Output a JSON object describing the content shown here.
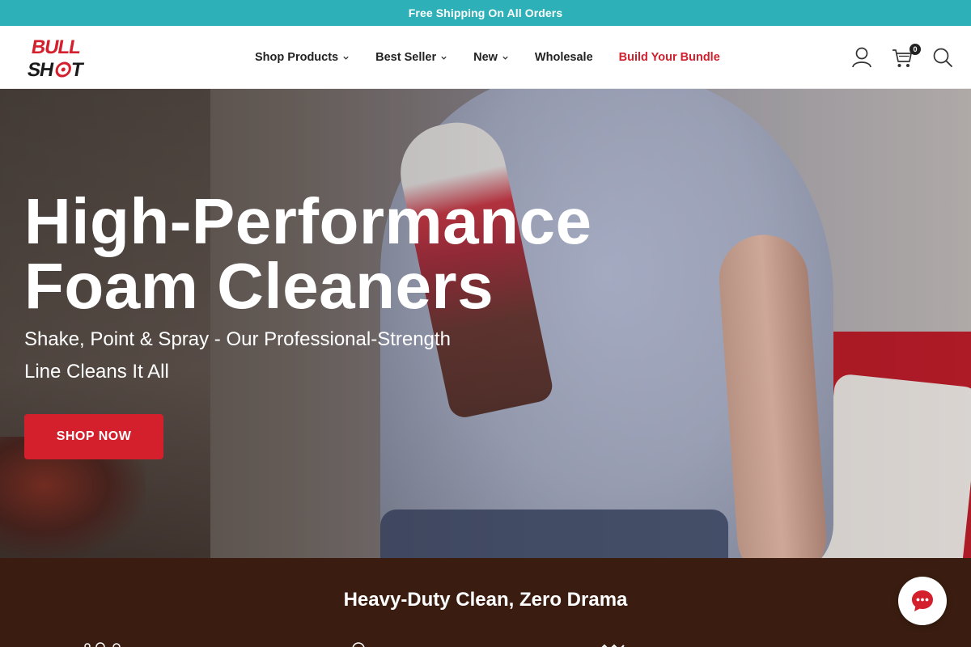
{
  "announcement": {
    "text": "Free Shipping On All Orders"
  },
  "brand": {
    "logo_line1": "BULL",
    "logo_line2": "SHOT",
    "logo_color": "#d41f2c"
  },
  "nav": {
    "items": [
      {
        "label": "Shop Products",
        "has_dropdown": true
      },
      {
        "label": "Best Seller",
        "has_dropdown": true
      },
      {
        "label": "New",
        "has_dropdown": true
      },
      {
        "label": "Wholesale",
        "has_dropdown": false
      },
      {
        "label": "Build Your Bundle",
        "has_dropdown": false,
        "accent": true
      }
    ]
  },
  "header_icons": {
    "account": "user-icon",
    "cart": "cart-icon",
    "cart_count": "0",
    "search": "search-icon"
  },
  "hero": {
    "title_line1": "High-Performance",
    "title_line2": "Foam Cleaners",
    "subtitle": "Shake, Point & Spray - Our Professional-Strength Line Cleans It All",
    "cta": "SHOP NOW"
  },
  "features": {
    "title": "Heavy-Duty Clean, Zero Drama"
  },
  "chat": {
    "icon": "chat-bubble-icon"
  },
  "colors": {
    "announcement_bg": "#2eb0b8",
    "accent_red": "#d41f2c",
    "feature_section_bg": "#3a1d10"
  }
}
